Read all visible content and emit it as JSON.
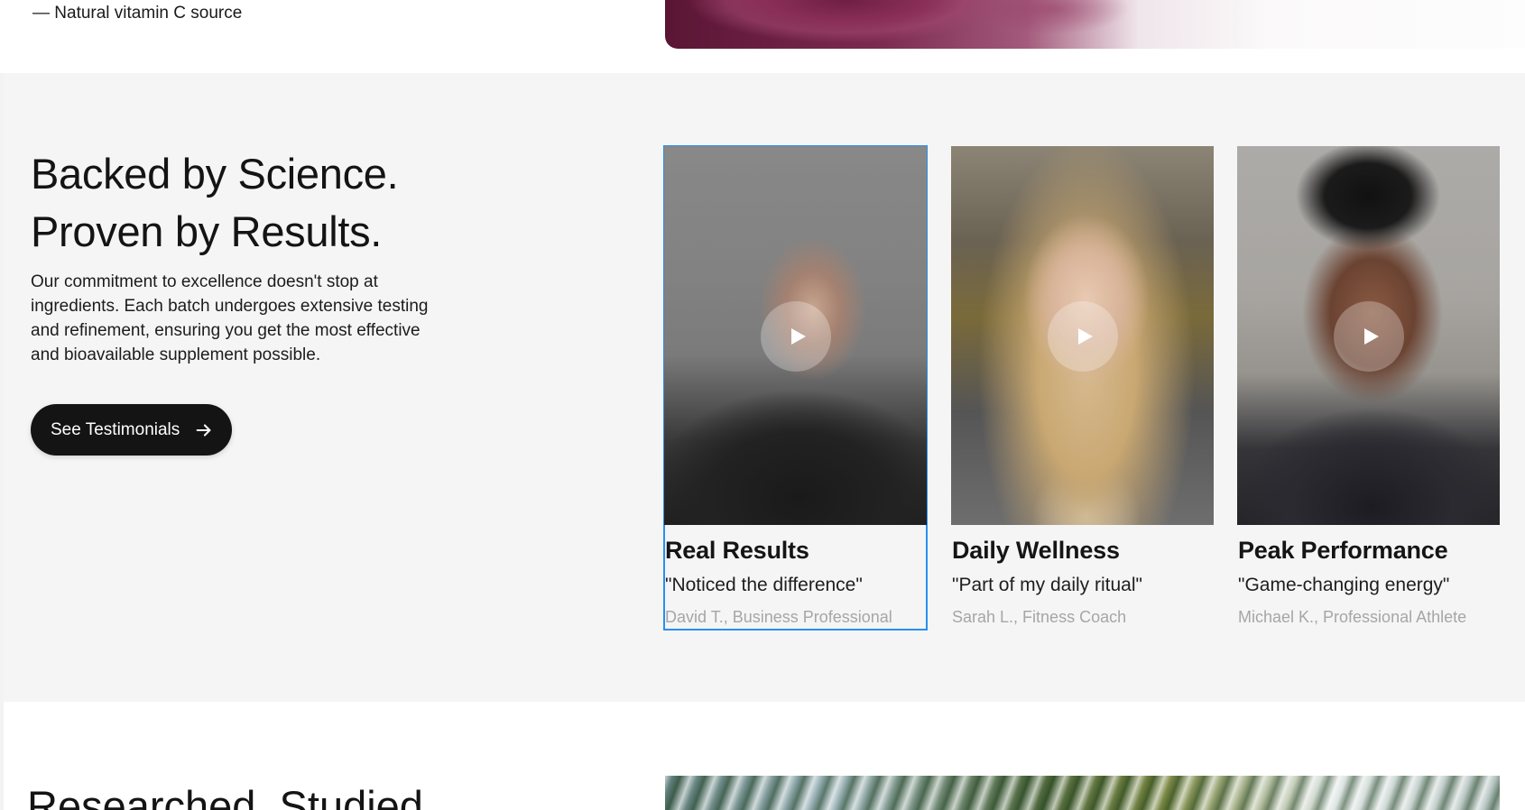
{
  "top": {
    "bullet_text": "— Natural vitamin C source",
    "image_icon": "powder-image"
  },
  "science": {
    "headline_line1": "Backed by Science.",
    "headline_line2": "Proven by Results.",
    "body": "Our commitment to excellence doesn't stop at ingredients. Each batch undergoes extensive testing and refinement, ensuring you get the most effective and bioavailable supplement possible.",
    "cta_label": "See Testimonials",
    "cta_icon": "arrow-right-icon"
  },
  "testimonials": [
    {
      "title": "Real Results",
      "quote": "\"Noticed the difference\"",
      "author": "David T., Business Professional",
      "selected": true
    },
    {
      "title": "Daily Wellness",
      "quote": "\"Part of my daily ritual\"",
      "author": "Sarah L., Fitness Coach",
      "selected": false
    },
    {
      "title": "Peak Performance",
      "quote": "\"Game-changing energy\"",
      "author": "Michael K., Professional Athlete",
      "selected": false
    }
  ],
  "bottom": {
    "headline": "Researched. Studied"
  },
  "colors": {
    "section_bg": "#f5f5f5",
    "button_bg": "#141414",
    "selection_outline": "#2a8ff0",
    "author_text": "#a6a6a6"
  }
}
